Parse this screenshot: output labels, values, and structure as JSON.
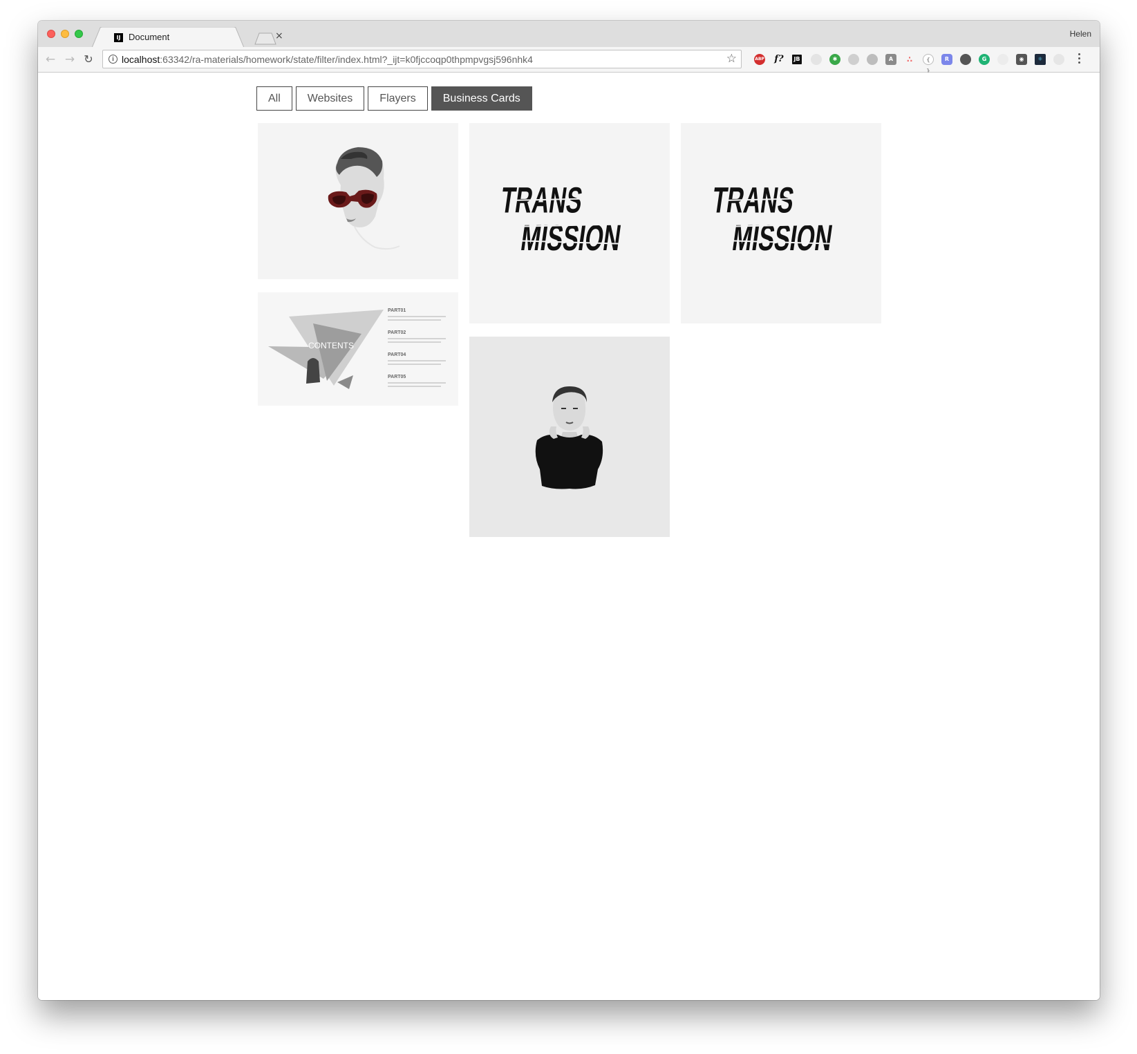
{
  "browser": {
    "tab_title": "Document",
    "tab_close": "×",
    "favicon_text": "IJ",
    "profile_name": "Helen",
    "url_host": "localhost",
    "url_rest": ":63342/ra-materials/homework/state/filter/index.html?_ijt=k0fjccoqp0thpmpvgsj596nhk4",
    "extensions": [
      "abp-icon",
      "font-icon",
      "jetbrains-icon",
      "extension-icon",
      "gear-extension-icon",
      "clock-icon",
      "drive-icon",
      "angular-icon",
      "asana-icon",
      "bracket-icon",
      "r-icon",
      "evernote-icon",
      "grammarly-icon",
      "extension-icon",
      "map-pin-icon",
      "react-icon",
      "shield-icon"
    ]
  },
  "filters": {
    "items": [
      "All",
      "Websites",
      "Flayers",
      "Business Cards"
    ],
    "selected": "Business Cards"
  },
  "gallery": {
    "items": [
      {
        "name": "woman-sunglasses-card"
      },
      {
        "name": "transmission-card-1",
        "text_line1": "TRANS",
        "text_line2": "MISSION"
      },
      {
        "name": "transmission-card-2",
        "text_line1": "TRANS",
        "text_line2": "MISSION"
      },
      {
        "name": "contents-presentation-card",
        "heading": "CONTENTS",
        "parts": [
          "PART01",
          "PART02",
          "PART04",
          "PART05"
        ]
      },
      {
        "name": "woman-black-sweater-card"
      }
    ]
  }
}
